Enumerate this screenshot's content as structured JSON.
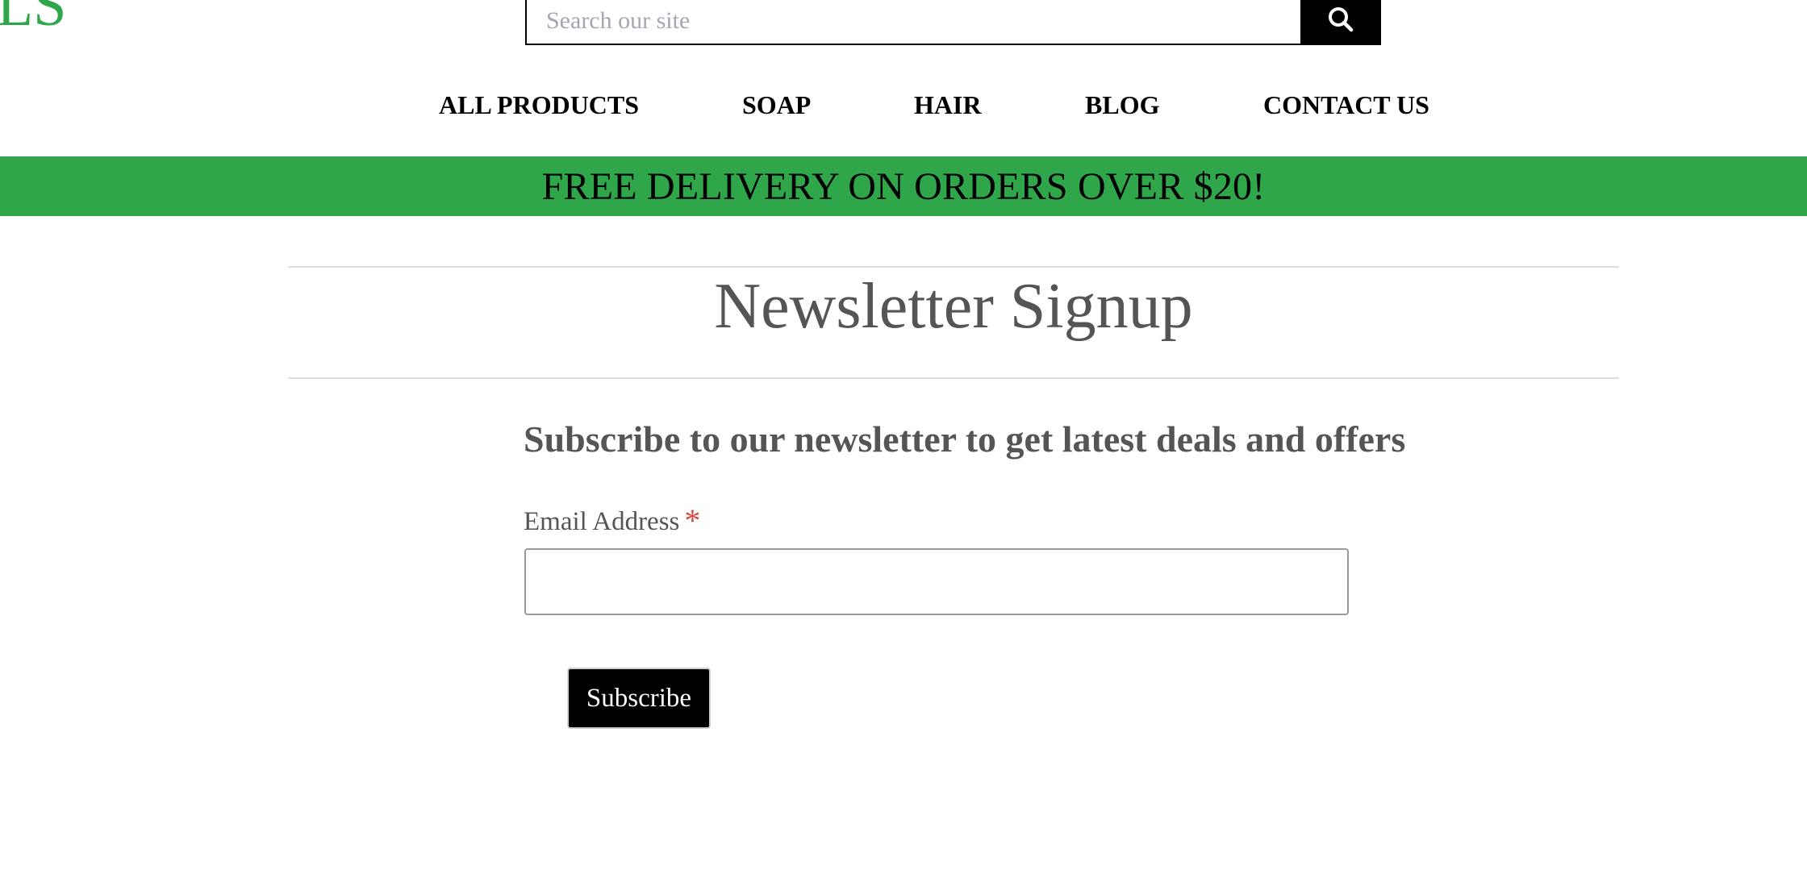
{
  "header": {
    "logo_text": "LS",
    "search": {
      "placeholder": "Search our site",
      "value": "",
      "button_icon": "search-icon"
    }
  },
  "nav": {
    "items": [
      {
        "label": "ALL PRODUCTS"
      },
      {
        "label": "SOAP"
      },
      {
        "label": "HAIR"
      },
      {
        "label": "BLOG"
      },
      {
        "label": "CONTACT US"
      }
    ]
  },
  "banner": {
    "text": "FREE DELIVERY ON ORDERS OVER $20!",
    "background_color": "#2fa64a"
  },
  "main": {
    "title": "Newsletter Signup",
    "subheading": "Subscribe to our newsletter to get latest deals and offers",
    "email_label": "Email Address",
    "required_marker": "*",
    "email_value": "",
    "subscribe_label": "Subscribe"
  },
  "colors": {
    "brand_green": "#2fa64a",
    "text_gray": "#555555",
    "required_red": "#d9483b"
  }
}
